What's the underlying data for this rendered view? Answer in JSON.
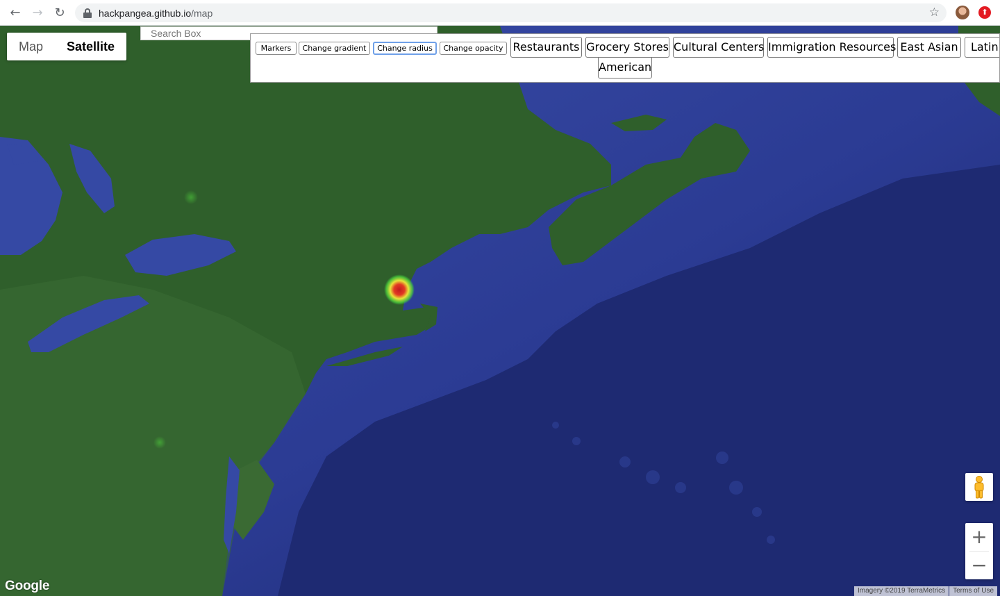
{
  "browser": {
    "url_host": "hackpangea.github.io",
    "url_path": "/map",
    "nav_back": "←",
    "nav_forward": "→",
    "nav_reload": "↻",
    "star_icon": "☆",
    "extension_icon": "⬆"
  },
  "map_type": {
    "map_label": "Map",
    "satellite_label": "Satellite",
    "selected": "Satellite"
  },
  "search": {
    "placeholder": "Search Box"
  },
  "panel": {
    "markers": "Markers",
    "change_gradient": "Change gradient",
    "change_radius": "Change radius",
    "change_opacity": "Change opacity",
    "restaurants": "Restaurants",
    "grocery_stores": "Grocery Stores",
    "cultural_centers": "Cultural Centers",
    "immigration_resources": "Immigration Resources",
    "east_asian": "East Asian",
    "latin_american_line1": "Latin",
    "latin_american_line2": "American"
  },
  "zoom": {
    "plus": "+",
    "minus": "−"
  },
  "attribution": {
    "logo": "Google",
    "imagery": "Imagery ©2019 TerraMetrics",
    "terms": "Terms of Use"
  },
  "colors": {
    "land": "#2f5f2b",
    "ocean": "#2a3c92",
    "deep_ocean": "#1b2667",
    "heat_center": "#d8242a"
  }
}
